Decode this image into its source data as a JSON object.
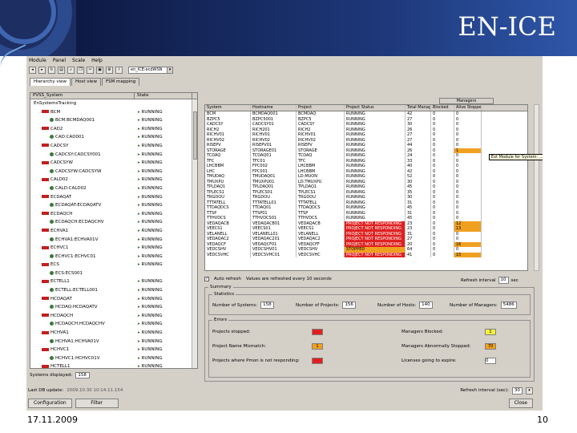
{
  "slide": {
    "title": "EN-ICE",
    "date": "17.11.2009",
    "page": "10"
  },
  "menu": [
    "Module",
    "Panel",
    "Scale",
    "Help"
  ],
  "toolbar": {
    "combo": "en_ICE:ecdWSN"
  },
  "tabs": [
    "Hierarchy view",
    "Host view",
    "FSM mapping"
  ],
  "tree": {
    "headers": [
      "PVSS_System",
      "State"
    ],
    "rows": [
      {
        "name": "EnSystemsTracking",
        "indent": 0,
        "icon": "none",
        "state": ""
      },
      {
        "name": "BCM",
        "indent": 1,
        "icon": "red",
        "state": "RUNNING"
      },
      {
        "name": "BCM:BCMDAQ001",
        "indent": 2,
        "icon": "green",
        "state": "RUNNING"
      },
      {
        "name": "CAD2",
        "indent": 1,
        "icon": "red",
        "state": "RUNNING"
      },
      {
        "name": "CAD:CAD001",
        "indent": 2,
        "icon": "green",
        "state": "RUNNING"
      },
      {
        "name": "CADCSY",
        "indent": 1,
        "icon": "red",
        "state": "RUNNING"
      },
      {
        "name": "CADCSY:CADCSY001",
        "indent": 2,
        "icon": "green",
        "state": "RUNNING"
      },
      {
        "name": "CADCSYW",
        "indent": 1,
        "icon": "red",
        "state": "RUNNING"
      },
      {
        "name": "CADCSYW:CADCSYW",
        "indent": 2,
        "icon": "green",
        "state": "RUNNING"
      },
      {
        "name": "CALD02",
        "indent": 1,
        "icon": "red",
        "state": "RUNNING"
      },
      {
        "name": "CALD:CALD02",
        "indent": 2,
        "icon": "green",
        "state": "RUNNING"
      },
      {
        "name": "ECDAQAT",
        "indent": 1,
        "icon": "red",
        "state": "RUNNING"
      },
      {
        "name": "ECDAQAT:ECDAQATV",
        "indent": 2,
        "icon": "green",
        "state": "RUNNING"
      },
      {
        "name": "ECDAQCH",
        "indent": 1,
        "icon": "red",
        "state": "RUNNING"
      },
      {
        "name": "ECDAQCH:ECDAQCHV",
        "indent": 2,
        "icon": "green",
        "state": "RUNNING"
      },
      {
        "name": "ECHVA1",
        "indent": 1,
        "icon": "red",
        "state": "RUNNING"
      },
      {
        "name": "ECHVA1:ECHVA01V",
        "indent": 2,
        "icon": "green",
        "state": "RUNNING"
      },
      {
        "name": "ECHVC1",
        "indent": 1,
        "icon": "red",
        "state": "RUNNING"
      },
      {
        "name": "ECHVC1:ECHVC01",
        "indent": 2,
        "icon": "green",
        "state": "RUNNING"
      },
      {
        "name": "ECS",
        "indent": 1,
        "icon": "red",
        "state": "RUNNING"
      },
      {
        "name": "ECS:ECS001",
        "indent": 2,
        "icon": "green",
        "state": ""
      },
      {
        "name": "ECTELL1",
        "indent": 1,
        "icon": "red",
        "state": "RUNNING"
      },
      {
        "name": "ECTELL:ECTELL001",
        "indent": 2,
        "icon": "green",
        "state": "RUNNING"
      },
      {
        "name": "HCDAQAT",
        "indent": 1,
        "icon": "red",
        "state": "RUNNING"
      },
      {
        "name": "HCDAQ:HCDAQATV",
        "indent": 2,
        "icon": "green",
        "state": "RUNNING"
      },
      {
        "name": "HCDAQCH",
        "indent": 1,
        "icon": "red",
        "state": "RUNNING"
      },
      {
        "name": "HCDAQCH:HCDAQCHV",
        "indent": 2,
        "icon": "green",
        "state": "RUNNING"
      },
      {
        "name": "HCHVA1",
        "indent": 1,
        "icon": "red",
        "state": "RUNNING"
      },
      {
        "name": "HCHVA1:HCHVA01V",
        "indent": 2,
        "icon": "green",
        "state": "RUNNING"
      },
      {
        "name": "HCHVC1",
        "indent": 1,
        "icon": "red",
        "state": "RUNNING"
      },
      {
        "name": "HCHVC1:HCHVC01V",
        "indent": 2,
        "icon": "green",
        "state": "RUNNING"
      },
      {
        "name": "HCTELL1",
        "indent": 1,
        "icon": "red",
        "state": "RUNNING"
      }
    ],
    "footer_label": "Systems displayed:",
    "footer_value": "158"
  },
  "grid": {
    "group_header": "Managers",
    "headers": [
      "System",
      "Hostname",
      "Project",
      "Project Status",
      "Total Managers",
      "Blocked",
      "Alive Stopped"
    ],
    "rows": [
      [
        "BCM",
        "BCMDAQ001",
        "BCMDAQ",
        "RUNNING",
        "42",
        "0",
        "0",
        ""
      ],
      [
        "BZPC5",
        "BZPC5001",
        "BZPC5",
        "RUNNING",
        "27",
        "0",
        "0",
        ""
      ],
      [
        "CADCSY",
        "CADCSY01",
        "CADCSY",
        "RUNNING",
        "30",
        "0",
        "0",
        ""
      ],
      [
        "RICH2",
        "RICH201",
        "RICH2",
        "RUNNING",
        "26",
        "0",
        "0",
        ""
      ],
      [
        "RICHV01",
        "RICHV01",
        "RICHV01",
        "RUNNING",
        "27",
        "0",
        "0",
        ""
      ],
      [
        "RICHV02",
        "RICHV02",
        "RICHV02",
        "RUNNING",
        "27",
        "0",
        "0",
        ""
      ],
      [
        "RISEPV",
        "RISEPV01",
        "RISEPV",
        "RUNNING",
        "44",
        "0",
        "0",
        ""
      ],
      [
        "STORAGE",
        "STORAGE01",
        "STORAGE",
        "RUNNING",
        "26",
        "0",
        "1",
        "warn"
      ],
      [
        "TCDAQ",
        "TCDAQ01",
        "TCDAQ",
        "RUNNING",
        "24",
        "0",
        "0",
        ""
      ],
      [
        "TFC",
        "TFC01",
        "TFC",
        "RUNNING",
        "33",
        "0",
        "0",
        ""
      ],
      [
        "LHCBBM",
        "FPC002",
        "LHCBBM",
        "RUNNING",
        "40",
        "0",
        "0",
        ""
      ],
      [
        "LHC",
        "FPC001",
        "LHCBBM",
        "RUNNING",
        "42",
        "0",
        "0",
        ""
      ],
      [
        "TMUDAQ",
        "TMUDAQ01",
        "LD:MUON",
        "RUNNING",
        "52",
        "0",
        "0",
        ""
      ],
      [
        "TMUXPU",
        "TMUXPU01",
        "LD:TMUXPU",
        "RUNNING",
        "30",
        "0",
        "0",
        ""
      ],
      [
        "TPLDAQ1",
        "TPLDAQ01",
        "TPLDAQ1",
        "RUNNING",
        "45",
        "0",
        "0",
        ""
      ],
      [
        "TPLECS1",
        "TPLECS01",
        "TPLECS1",
        "RUNNING",
        "35",
        "0",
        "0",
        ""
      ],
      [
        "TRGDOU",
        "TRGDOU",
        "TRGDOU",
        "RUNNING",
        "30",
        "0",
        "0",
        ""
      ],
      [
        "TTTATELL",
        "TTTATELL01",
        "TTTATELL",
        "RUNNING",
        "31",
        "0",
        "0",
        ""
      ],
      [
        "TTDAQDCS",
        "TTDAQ01",
        "TTDAQDCS",
        "RUNNING",
        "45",
        "0",
        "0",
        ""
      ],
      [
        "TTSP",
        "TTSP01",
        "TTSP",
        "RUNNING",
        "31",
        "0",
        "0",
        ""
      ],
      [
        "TTHVDCS",
        "TTHVDCS01",
        "TTHVDCS",
        "RUNNING",
        "45",
        "0",
        "0",
        ""
      ],
      [
        "VEDAQACB",
        "VEDAQACB01",
        "VEDAQACB",
        "PROJECT NOT RESPONDING",
        "23",
        "0",
        "12",
        "bad"
      ],
      [
        "VEECS1",
        "VEECS01",
        "VEECS1",
        "PROJECT NOT RESPONDING",
        "23",
        "0",
        "13",
        "bad"
      ],
      [
        "VELANELL",
        "VELANELL01",
        "VELANELL",
        "PROJECT NOT RESPONDING",
        "31",
        "0",
        "0",
        "bad"
      ],
      [
        "VEDAQAC2",
        "VEDAQAC201",
        "VEDAQAC2",
        "PROJECT NOT RESPONDING",
        "27",
        "0",
        "0",
        "bad"
      ],
      [
        "VEDAQCF",
        "VEDAQCF01",
        "VEDAQCFF",
        "PROJECT NOT RESPONDING",
        "20",
        "0",
        "16",
        "bad"
      ],
      [
        "VEDCSHV",
        "VEDCSHV01",
        "VEDCSHV",
        "STOPPED",
        "64",
        "0",
        "0",
        "stop"
      ],
      [
        "VEDCSVHC",
        "VEDCSVHC01",
        "VEDCSVHC",
        "PROJECT NOT RESPONDING",
        "41",
        "0",
        "15",
        "bad"
      ]
    ],
    "tooltip": "Ext Module for System: ..."
  },
  "auto": {
    "label": "Auto refresh",
    "note": "Values are refreshed every 10 seconds",
    "refresh_label": "Refresh interval",
    "refresh_value": "10",
    "refresh_unit": "sec"
  },
  "summary": {
    "title": "Summary",
    "statistics_title": "Statistics",
    "stats": [
      {
        "label": "Number of Systems:",
        "value": "158"
      },
      {
        "label": "Number of Projects:",
        "value": "156"
      },
      {
        "label": "Number of Hosts:",
        "value": "140"
      },
      {
        "label": "Number of Managers:",
        "value": "5486"
      }
    ],
    "errors_title": "Errors",
    "errors_left": [
      {
        "label": "Projects stopped:",
        "value": "",
        "color": "red"
      },
      {
        "label": "Project Name Mismatch:",
        "value": "1",
        "color": "org"
      },
      {
        "label": "Projects where Pmon is not responding:",
        "value": "",
        "color": "red"
      }
    ],
    "errors_right": [
      {
        "label": "Managers Blocked:",
        "value": "1",
        "color": "yel"
      },
      {
        "label": "Managers Abnormally Stopped:",
        "value": "70",
        "color": "org"
      },
      {
        "label": "Licenses going to expire:",
        "value": "0",
        "color": "none"
      }
    ]
  },
  "status": {
    "last_update_label": "Last DB update:",
    "last_update_value": "2009.10.30 10:14:11.154",
    "refresh_label": "Refresh interval (sec):",
    "refresh_value": "30"
  },
  "buttons": {
    "configuration": "Configuration",
    "filter": "Filter",
    "close": "Close"
  }
}
